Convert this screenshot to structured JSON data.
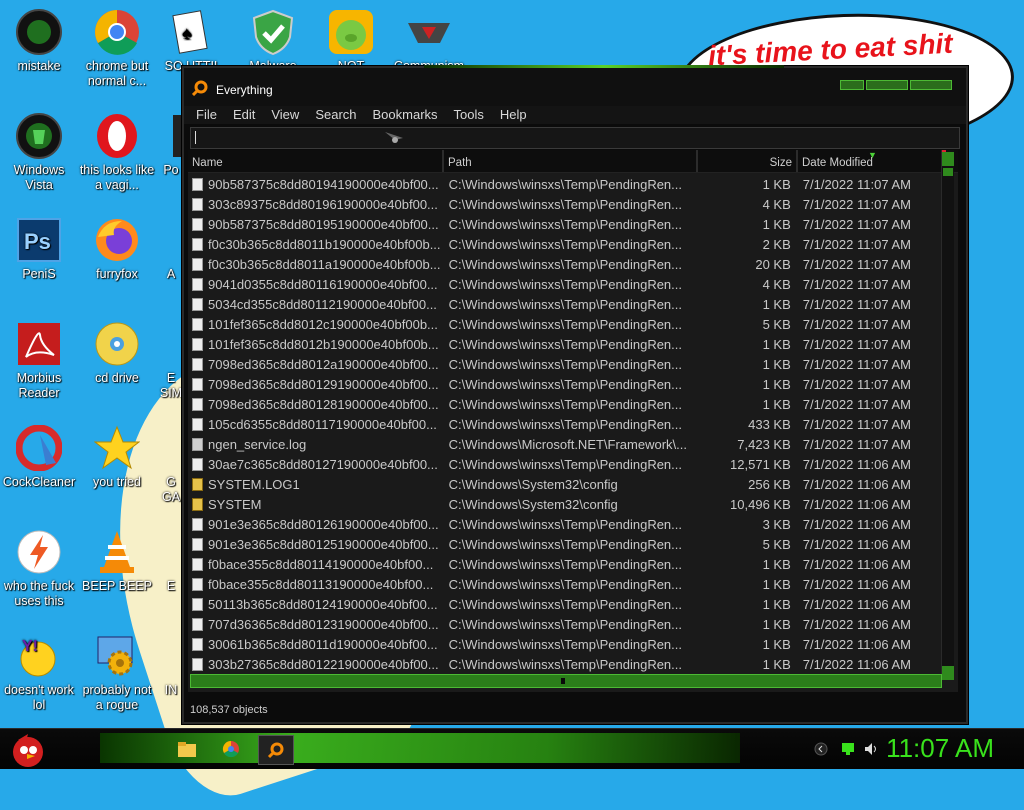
{
  "desktop": {
    "speech_text": "it's time to eat shit",
    "icons": [
      {
        "label": "mistake",
        "icon": "razer-icon"
      },
      {
        "label": "chrome but normal c...",
        "icon": "chrome-icon"
      },
      {
        "label": "SO UTTI!",
        "icon": "solitaire-icon"
      },
      {
        "label": "Malware",
        "icon": "shield-icon"
      },
      {
        "label": "NOT",
        "icon": "angry-birds-pig-icon"
      },
      {
        "label": "Communism",
        "icon": "communism-icon"
      },
      {
        "label": "Windows Vista",
        "icon": "recycle-bin-icon"
      },
      {
        "label": "this looks like a vagi...",
        "icon": "opera-icon"
      },
      {
        "label": "Po",
        "icon": "app-icon"
      },
      {
        "label": "PeniS",
        "icon": "photoshop-icon"
      },
      {
        "label": "furryfox",
        "icon": "firefox-icon"
      },
      {
        "label": "A",
        "icon": "app-icon"
      },
      {
        "label": "Morbius Reader",
        "icon": "acrobat-icon"
      },
      {
        "label": "cd drive",
        "icon": "cd-icon"
      },
      {
        "label": "E SIM",
        "icon": "app-icon"
      },
      {
        "label": "CockCleaner",
        "icon": "ccleaner-icon"
      },
      {
        "label": "you tried",
        "icon": "star-icon"
      },
      {
        "label": "G GA",
        "icon": "app-icon"
      },
      {
        "label": "who the fuck uses this",
        "icon": "flash-icon"
      },
      {
        "label": "BEEP BEEP",
        "icon": "vlc-icon"
      },
      {
        "label": "E",
        "icon": "app-icon"
      },
      {
        "label": "doesn't work lol",
        "icon": "yahoo-messenger-icon"
      },
      {
        "label": "probably not a rogue",
        "icon": "settings-gears-icon"
      },
      {
        "label": "IN",
        "icon": "app-icon"
      }
    ]
  },
  "window": {
    "title": "Everything",
    "menu": [
      "File",
      "Edit",
      "View",
      "Search",
      "Bookmarks",
      "Tools",
      "Help"
    ],
    "search_value": "",
    "columns": {
      "name": "Name",
      "path": "Path",
      "size": "Size",
      "date": "Date Modified"
    },
    "rows": [
      {
        "name": "90b587375c8dd80194190000e40bf00...",
        "path": "C:\\Windows\\winsxs\\Temp\\PendingRen...",
        "size": "1 KB",
        "date": "7/1/2022 11:07 AM",
        "icon": "file"
      },
      {
        "name": "303c89375c8dd80196190000e40bf00...",
        "path": "C:\\Windows\\winsxs\\Temp\\PendingRen...",
        "size": "4 KB",
        "date": "7/1/2022 11:07 AM",
        "icon": "file"
      },
      {
        "name": "90b587375c8dd80195190000e40bf00...",
        "path": "C:\\Windows\\winsxs\\Temp\\PendingRen...",
        "size": "1 KB",
        "date": "7/1/2022 11:07 AM",
        "icon": "file"
      },
      {
        "name": "f0c30b365c8dd8011b190000e40bf00b...",
        "path": "C:\\Windows\\winsxs\\Temp\\PendingRen...",
        "size": "2 KB",
        "date": "7/1/2022 11:07 AM",
        "icon": "file"
      },
      {
        "name": "f0c30b365c8dd8011a190000e40bf00b...",
        "path": "C:\\Windows\\winsxs\\Temp\\PendingRen...",
        "size": "20 KB",
        "date": "7/1/2022 11:07 AM",
        "icon": "file"
      },
      {
        "name": "9041d0355c8dd80116190000e40bf00...",
        "path": "C:\\Windows\\winsxs\\Temp\\PendingRen...",
        "size": "4 KB",
        "date": "7/1/2022 11:07 AM",
        "icon": "file"
      },
      {
        "name": "5034cd355c8dd80112190000e40bf00...",
        "path": "C:\\Windows\\winsxs\\Temp\\PendingRen...",
        "size": "1 KB",
        "date": "7/1/2022 11:07 AM",
        "icon": "file"
      },
      {
        "name": "101fef365c8dd8012c190000e40bf00b...",
        "path": "C:\\Windows\\winsxs\\Temp\\PendingRen...",
        "size": "5 KB",
        "date": "7/1/2022 11:07 AM",
        "icon": "file"
      },
      {
        "name": "101fef365c8dd8012b190000e40bf00b...",
        "path": "C:\\Windows\\winsxs\\Temp\\PendingRen...",
        "size": "1 KB",
        "date": "7/1/2022 11:07 AM",
        "icon": "file"
      },
      {
        "name": "7098ed365c8dd8012a190000e40bf00...",
        "path": "C:\\Windows\\winsxs\\Temp\\PendingRen...",
        "size": "1 KB",
        "date": "7/1/2022 11:07 AM",
        "icon": "file"
      },
      {
        "name": "7098ed365c8dd80129190000e40bf00...",
        "path": "C:\\Windows\\winsxs\\Temp\\PendingRen...",
        "size": "1 KB",
        "date": "7/1/2022 11:07 AM",
        "icon": "file"
      },
      {
        "name": "7098ed365c8dd80128190000e40bf00...",
        "path": "C:\\Windows\\winsxs\\Temp\\PendingRen...",
        "size": "1 KB",
        "date": "7/1/2022 11:07 AM",
        "icon": "file"
      },
      {
        "name": "105cd6355c8dd80117190000e40bf00...",
        "path": "C:\\Windows\\winsxs\\Temp\\PendingRen...",
        "size": "433 KB",
        "date": "7/1/2022 11:07 AM",
        "icon": "file"
      },
      {
        "name": "ngen_service.log",
        "path": "C:\\Windows\\Microsoft.NET\\Framework\\...",
        "size": "7,423 KB",
        "date": "7/1/2022 11:07 AM",
        "icon": "log"
      },
      {
        "name": "30ae7c365c8dd80127190000e40bf00...",
        "path": "C:\\Windows\\winsxs\\Temp\\PendingRen...",
        "size": "12,571 KB",
        "date": "7/1/2022 11:06 AM",
        "icon": "file"
      },
      {
        "name": "SYSTEM.LOG1",
        "path": "C:\\Windows\\System32\\config",
        "size": "256 KB",
        "date": "7/1/2022 11:06 AM",
        "icon": "lock"
      },
      {
        "name": "SYSTEM",
        "path": "C:\\Windows\\System32\\config",
        "size": "10,496 KB",
        "date": "7/1/2022 11:06 AM",
        "icon": "lock"
      },
      {
        "name": "901e3e365c8dd80126190000e40bf00...",
        "path": "C:\\Windows\\winsxs\\Temp\\PendingRen...",
        "size": "3 KB",
        "date": "7/1/2022 11:06 AM",
        "icon": "file"
      },
      {
        "name": "901e3e365c8dd80125190000e40bf00...",
        "path": "C:\\Windows\\winsxs\\Temp\\PendingRen...",
        "size": "5 KB",
        "date": "7/1/2022 11:06 AM",
        "icon": "file"
      },
      {
        "name": "f0bace355c8dd80114190000e40bf00...",
        "path": "C:\\Windows\\winsxs\\Temp\\PendingRen...",
        "size": "1 KB",
        "date": "7/1/2022 11:06 AM",
        "icon": "file"
      },
      {
        "name": "f0bace355c8dd80113190000e40bf00...",
        "path": "C:\\Windows\\winsxs\\Temp\\PendingRen...",
        "size": "1 KB",
        "date": "7/1/2022 11:06 AM",
        "icon": "file"
      },
      {
        "name": "50113b365c8dd80124190000e40bf00...",
        "path": "C:\\Windows\\winsxs\\Temp\\PendingRen...",
        "size": "1 KB",
        "date": "7/1/2022 11:06 AM",
        "icon": "file"
      },
      {
        "name": "707d36365c8dd80123190000e40bf00...",
        "path": "C:\\Windows\\winsxs\\Temp\\PendingRen...",
        "size": "1 KB",
        "date": "7/1/2022 11:06 AM",
        "icon": "file"
      },
      {
        "name": "30061b365c8dd8011d190000e40bf00...",
        "path": "C:\\Windows\\winsxs\\Temp\\PendingRen...",
        "size": "1 KB",
        "date": "7/1/2022 11:06 AM",
        "icon": "file"
      },
      {
        "name": "303b27365c8dd80122190000e40bf00...",
        "path": "C:\\Windows\\winsxs\\Temp\\PendingRen...",
        "size": "1 KB",
        "date": "7/1/2022 11:06 AM",
        "icon": "file"
      }
    ],
    "status": "108,537 objects"
  },
  "taskbar": {
    "start_icon": "angry-bird-start-icon",
    "pinned": [
      "folder-icon",
      "chrome-icon",
      "everything-search-icon"
    ],
    "clock": "11:07 AM"
  },
  "colors": {
    "accent_green": "#39e21c",
    "desktop_blue": "#27a9e9",
    "speech_red": "#e8131b"
  }
}
